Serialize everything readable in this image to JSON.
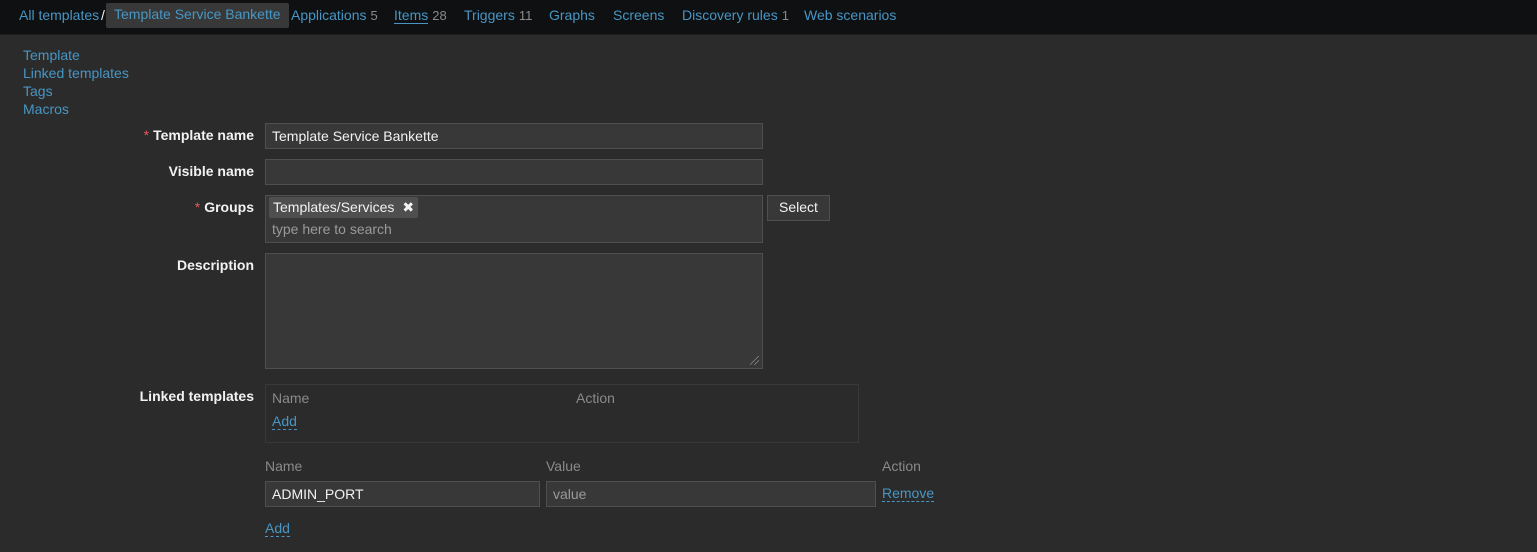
{
  "breadcrumb": {
    "all_templates": "All templates",
    "separator": "/",
    "current": "Template Service Bankette"
  },
  "tabs": [
    {
      "label": "Applications",
      "count": "5"
    },
    {
      "label": "Items",
      "count": "28"
    },
    {
      "label": "Triggers",
      "count": "11"
    },
    {
      "label": "Graphs",
      "count": ""
    },
    {
      "label": "Screens",
      "count": ""
    },
    {
      "label": "Discovery rules",
      "count": "1"
    },
    {
      "label": "Web scenarios",
      "count": ""
    }
  ],
  "side_links": [
    "Template",
    "Linked templates",
    "Tags",
    "Macros"
  ],
  "form": {
    "required_mark": "*",
    "template_name_label": "Template name",
    "template_name_value": "Template Service Bankette",
    "visible_name_label": "Visible name",
    "visible_name_value": "",
    "groups_label": "Groups",
    "group_chip": "Templates/Services",
    "group_chip_remove": "✖",
    "groups_search_placeholder": "type here to search",
    "select_button": "Select",
    "description_label": "Description",
    "description_value": "",
    "linked_templates_label": "Linked templates",
    "linked_col_name": "Name",
    "linked_col_action": "Action",
    "linked_add": "Add"
  },
  "macros": {
    "col_name": "Name",
    "col_value": "Value",
    "col_action": "Action",
    "row_name": "ADMIN_PORT",
    "row_value_placeholder": "value",
    "remove": "Remove",
    "add": "Add"
  },
  "colors": {
    "link": "#4796c4",
    "background": "#2b2b2b",
    "topbar": "#0e1012",
    "required": "#e45959"
  }
}
